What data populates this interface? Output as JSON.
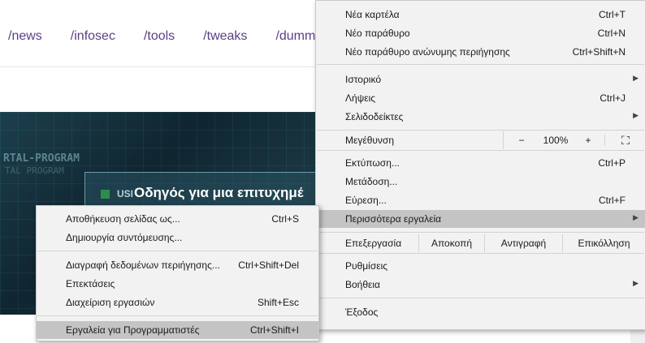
{
  "page": {
    "nav": [
      "/news",
      "/infosec",
      "/tools",
      "/tweaks",
      "/dummies"
    ],
    "hero_title": "Οδηγός για μια επιτυχημέ",
    "hero_line1": "RTAL-PROGRAM",
    "hero_line2": "TAL PROGRAM",
    "hero_box_text": "USI"
  },
  "main_menu": {
    "new_tab": {
      "label": "Νέα καρτέλα",
      "shortcut": "Ctrl+T"
    },
    "new_window": {
      "label": "Νέο παράθυρο",
      "shortcut": "Ctrl+N"
    },
    "incognito": {
      "label": "Νέο παράθυρο ανώνυμης περιήγησης",
      "shortcut": "Ctrl+Shift+N"
    },
    "history": {
      "label": "Ιστορικό"
    },
    "downloads": {
      "label": "Λήψεις",
      "shortcut": "Ctrl+J"
    },
    "bookmarks": {
      "label": "Σελιδοδείκτες"
    },
    "zoom": {
      "label": "Μεγέθυνση",
      "minus": "−",
      "value": "100%",
      "plus": "+",
      "fullscreen": "⛶"
    },
    "print": {
      "label": "Εκτύπωση...",
      "shortcut": "Ctrl+P"
    },
    "cast": {
      "label": "Μετάδοση..."
    },
    "find": {
      "label": "Εύρεση...",
      "shortcut": "Ctrl+F"
    },
    "more_tools": {
      "label": "Περισσότερα εργαλεία"
    },
    "edit": {
      "label": "Επεξεργασία",
      "cut": "Αποκοπή",
      "copy": "Αντιγραφή",
      "paste": "Επικόλληση"
    },
    "settings": {
      "label": "Ρυθμίσεις"
    },
    "help": {
      "label": "Βοήθεια"
    },
    "exit": {
      "label": "Έξοδος"
    }
  },
  "sub_menu": {
    "save_page": {
      "label": "Αποθήκευση σελίδας ως...",
      "shortcut": "Ctrl+S"
    },
    "create_shortcut": {
      "label": "Δημιουργία συντόμευσης..."
    },
    "clear_data": {
      "label": "Διαγραφή δεδομένων περιήγησης...",
      "shortcut": "Ctrl+Shift+Del"
    },
    "extensions": {
      "label": "Επεκτάσεις"
    },
    "task_manager": {
      "label": "Διαχείριση εργασιών",
      "shortcut": "Shift+Esc"
    },
    "dev_tools": {
      "label": "Εργαλεία για Προγραμματιστές",
      "shortcut": "Ctrl+Shift+I"
    }
  },
  "icons": {
    "submenu_arrow": "▶"
  }
}
